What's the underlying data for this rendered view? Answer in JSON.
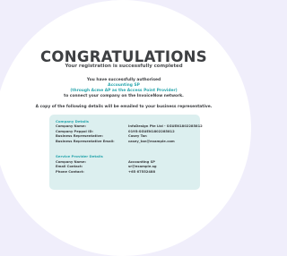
{
  "header": {
    "title": "CONGRATULATIONS",
    "subtitle": "Your registration is successfully completed"
  },
  "authorisation": {
    "line1": "You have successfully authorised",
    "provider": "Accounting SP",
    "via": "(through Acme AP as the Access Point Provider)",
    "line4": "to connect your company on the InvoiceNow network."
  },
  "copy_note": "A copy of the following details will be emailed to your business representative.",
  "company_details": {
    "title": "Company Details",
    "rows": [
      {
        "label": "Company Name:",
        "value": "InfoDesign Pte Ltd - SGUEN1802285812"
      },
      {
        "label": "Company Peppol ID:",
        "value": "0195:SGUEN1802285812"
      },
      {
        "label": "Business Representative:",
        "value": "Casey Tan"
      },
      {
        "label": "Business Representative Email:",
        "value": "casey_tan@example.com"
      }
    ]
  },
  "service_provider_details": {
    "title": "Service Provider Details",
    "rows": [
      {
        "label": "Company Name:",
        "value": "Accounting SP"
      },
      {
        "label": "Email Contact:",
        "value": "sr@example.sg"
      },
      {
        "label": "Phone Contact:",
        "value": "+65 67552488"
      }
    ]
  },
  "colors": {
    "background": "#f0eefb",
    "panel": "#ffffff",
    "accent": "#2aa6ad",
    "card": "#dcefef",
    "text": "#3d3f42"
  }
}
